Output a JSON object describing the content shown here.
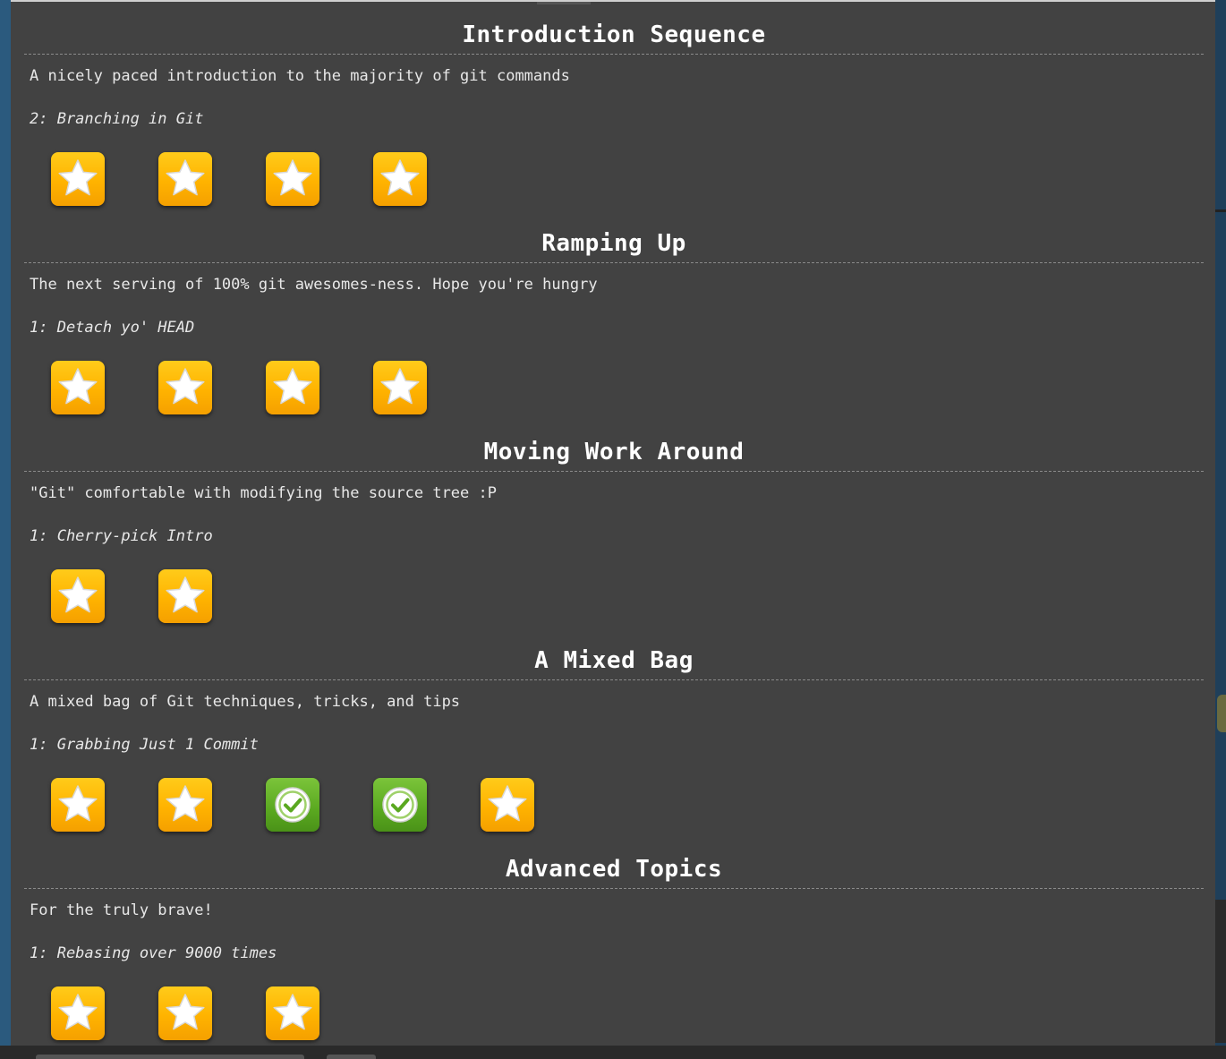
{
  "colors": {
    "panel_bg": "#424242",
    "star_tile": "#ffb300",
    "solved_tile": "#5aa820",
    "text": "#e8e8e8"
  },
  "sequences": [
    {
      "title": "Introduction Sequence",
      "about": "A nicely paced introduction to the majority of git commands",
      "current": "2: Branching in Git",
      "levels": [
        "star",
        "star",
        "star",
        "star"
      ]
    },
    {
      "title": "Ramping Up",
      "about": "The next serving of 100% git awesomes-ness. Hope you're hungry",
      "current": "1: Detach yo' HEAD",
      "levels": [
        "star",
        "star",
        "star",
        "star"
      ]
    },
    {
      "title": "Moving Work Around",
      "about": "\"Git\" comfortable with modifying the source tree :P",
      "current": "1: Cherry-pick Intro",
      "levels": [
        "star",
        "star"
      ]
    },
    {
      "title": "A Mixed Bag",
      "about": "A mixed bag of Git techniques, tricks, and tips",
      "current": "1: Grabbing Just 1 Commit",
      "levels": [
        "star",
        "star",
        "check",
        "check",
        "star"
      ]
    },
    {
      "title": "Advanced Topics",
      "about": "For the truly brave!",
      "current": "1: Rebasing over 9000 times",
      "levels": [
        "star",
        "star",
        "star"
      ]
    }
  ]
}
